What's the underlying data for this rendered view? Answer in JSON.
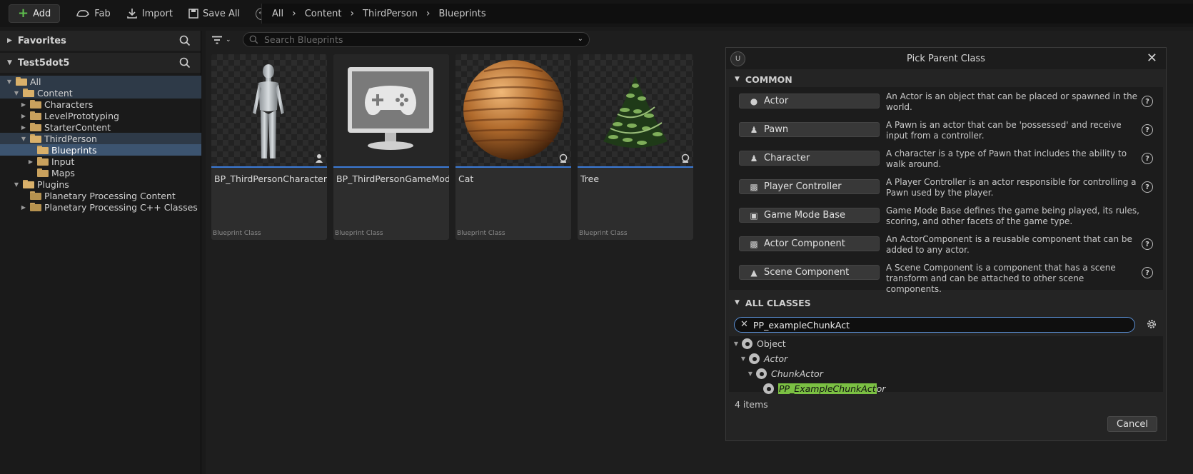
{
  "toolbar": {
    "add_label": "Add",
    "fab_label": "Fab",
    "import_label": "Import",
    "save_all_label": "Save All"
  },
  "breadcrumb": [
    "All",
    "Content",
    "ThirdPerson",
    "Blueprints"
  ],
  "favorites": {
    "title": "Favorites"
  },
  "project": {
    "title": "Test5dot5"
  },
  "tree": [
    {
      "label": "All"
    },
    {
      "label": "Content"
    },
    {
      "label": "Characters"
    },
    {
      "label": "LevelPrototyping"
    },
    {
      "label": "StarterContent"
    },
    {
      "label": "ThirdPerson"
    },
    {
      "label": "Blueprints"
    },
    {
      "label": "Input"
    },
    {
      "label": "Maps"
    },
    {
      "label": "Plugins"
    },
    {
      "label": "Planetary Processing Content"
    },
    {
      "label": "Planetary Processing C++ Classes"
    }
  ],
  "search": {
    "placeholder": "Search Blueprints"
  },
  "assets": [
    {
      "name": "BP_ThirdPersonCharacter",
      "type": "Blueprint Class"
    },
    {
      "name": "BP_ThirdPersonGameMode",
      "type": "Blueprint Class"
    },
    {
      "name": "Cat",
      "type": "Blueprint Class"
    },
    {
      "name": "Tree",
      "type": "Blueprint Class"
    }
  ],
  "dialog": {
    "title": "Pick Parent Class",
    "common_header": "COMMON",
    "all_classes_header": "ALL CLASSES",
    "common": [
      {
        "label": "Actor",
        "desc": "An Actor is an object that can be placed or spawned in the world.",
        "icon": "actor-icon"
      },
      {
        "label": "Pawn",
        "desc": "A Pawn is an actor that can be 'possessed' and receive input from a controller.",
        "icon": "pawn-icon"
      },
      {
        "label": "Character",
        "desc": "A character is a type of Pawn that includes the ability to walk around.",
        "icon": "character-icon"
      },
      {
        "label": "Player Controller",
        "desc": "A Player Controller is an actor responsible for controlling a Pawn used by the player.",
        "icon": "gamepad-icon"
      },
      {
        "label": "Game Mode Base",
        "desc": "Game Mode Base defines the game being played, its rules, scoring, and other facets of the game type.",
        "icon": "game-mode-icon"
      },
      {
        "label": "Actor Component",
        "desc": "An ActorComponent is a reusable component that can be added to any actor.",
        "icon": "component-icon"
      },
      {
        "label": "Scene Component",
        "desc": "A Scene Component is a component that has a scene transform and can be attached to other scene components.",
        "icon": "scene-component-icon"
      }
    ],
    "filter_value": "PP_exampleChunkAct",
    "class_tree": {
      "object": "Object",
      "actor": "Actor",
      "chunk_actor": "ChunkActor",
      "match_part": "PP_ExampleChunkAct",
      "rest_part": "or"
    },
    "items_count": "4 items",
    "cancel_label": "Cancel"
  }
}
